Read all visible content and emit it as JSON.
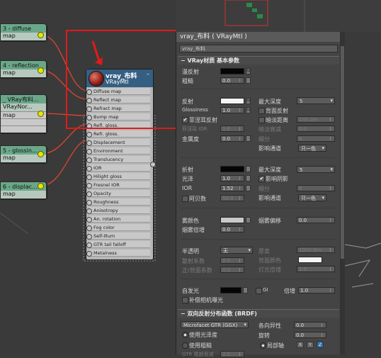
{
  "slate": {
    "left_nodes": [
      {
        "title": "3 - diffuse",
        "sub": "map",
        "rows": 0
      },
      {
        "title": "4 - reflection",
        "sub": "map",
        "rows": 0
      },
      {
        "title": "_ VRay布料...",
        "sub": "VRayNor...",
        "rows": 3,
        "row_labels": [
          "map",
          "",
          ""
        ]
      },
      {
        "title": "5 - glossin...",
        "sub": "map",
        "rows": 0
      },
      {
        "title": "6 - displac...",
        "sub": "map",
        "rows": 0
      }
    ],
    "material_node": {
      "name": "vray_布料",
      "type": "VRayMtl",
      "slots": [
        "Diffuse map",
        "Reflect map",
        "Refract map",
        "Bump map",
        "Refl. gloss.",
        "Refr. gloss.",
        "Displacement",
        "Environment",
        "Translucency",
        "IOR",
        "Hilight gloss",
        "Fresnel IOR",
        "Opacity",
        "Roughness",
        "Anisotropy",
        "An. rotation",
        "Fog color",
        "Self-Illum",
        "GTR tail falloff",
        "Metalness"
      ]
    }
  },
  "panel": {
    "title": "vray_布料 ( VRayMtl )",
    "material_name": "vray_布料",
    "basic_rollout": "VRay材质 基本参数",
    "diffuse_label": "漫反射",
    "roughness_label": "粗糙",
    "roughness_value": "0.0",
    "reflect_label": "反射",
    "glossiness_label": "Glossiness",
    "glossiness_value": "1.0",
    "fresnel_label": "菲涅耳反射",
    "fresnel_ior_label": "菲涅耳 IOR",
    "fresnel_ior_value": "1.6",
    "metalness_label": "金属度",
    "metalness_value": "0.0",
    "max_depth_label": "最大深度",
    "max_depth_value": "5",
    "back_reflect_label": "背面反射",
    "dim_distance_label": "暗淡距离",
    "dim_distance_value": "100.0m",
    "dim_falloff_label": "暗淡衰减",
    "dim_falloff_value": "0.0",
    "subdivs_label": "细分",
    "subdivs_value": "8",
    "affect_channels_label": "影响通道",
    "affect_channels_value": "只一色",
    "refract_label": "折射",
    "refract_gloss_label": "光泽",
    "refract_gloss_value": "1.0",
    "ior_label": "IOR",
    "ior_value": "1.52",
    "abbe_label": "阿贝数",
    "abbe_value": "50.0",
    "refract_max_depth_value": "5",
    "affect_shadows_label": "影响阴影",
    "refract_subdivs_value": "8",
    "refract_affect_value": "只一色",
    "fog_color_label": "雾颜色",
    "fog_bias_label": "烟雾偏移",
    "fog_bias_value": "0.0",
    "fog_mult_label": "烟雾倍增",
    "fog_mult_value": "0.0",
    "translucency_label": "半透明",
    "translucency_value": "无",
    "thickness_label": "厚度",
    "thickness_value": "1000.0m",
    "scatter_coeff_label": "散射系数",
    "scatter_coeff_value": "0.0",
    "back_color_label": "背面颜色",
    "fwd_bwd_label": "正/背面系数",
    "fwd_bwd_value": "0.0",
    "light_mult_label": "灯光倍增",
    "light_mult_value": "1.0",
    "self_illum_label": "自发光",
    "gi_label": "GI",
    "self_illum_mult_label": "倍增",
    "self_illum_mult_value": "1.0",
    "compensate_camera_label": "补偿相机曝光",
    "brdf_rollout": "双向反射分布函数 (BRDF)",
    "brdf_type_value": "Microfacet GTR (GGX)",
    "anisotropy_label": "各向异性",
    "anisotropy_value": "0.0",
    "rotation_label": "旋转",
    "rotation_value": "0.0",
    "use_glossiness_label": "使用光泽度",
    "use_roughness_label": "使用粗糙",
    "local_axis_label": "局部轴",
    "axis_x": "X",
    "axis_y": "Y",
    "axis_z": "Z",
    "gtr_tail_label": "GTR 尾部衰减",
    "gtr_tail_value": "2.0"
  },
  "colors": {
    "node_header": "#355f82",
    "left_node": "#6aa789",
    "wire": "#e04030",
    "highlight": "#e21a1a"
  }
}
